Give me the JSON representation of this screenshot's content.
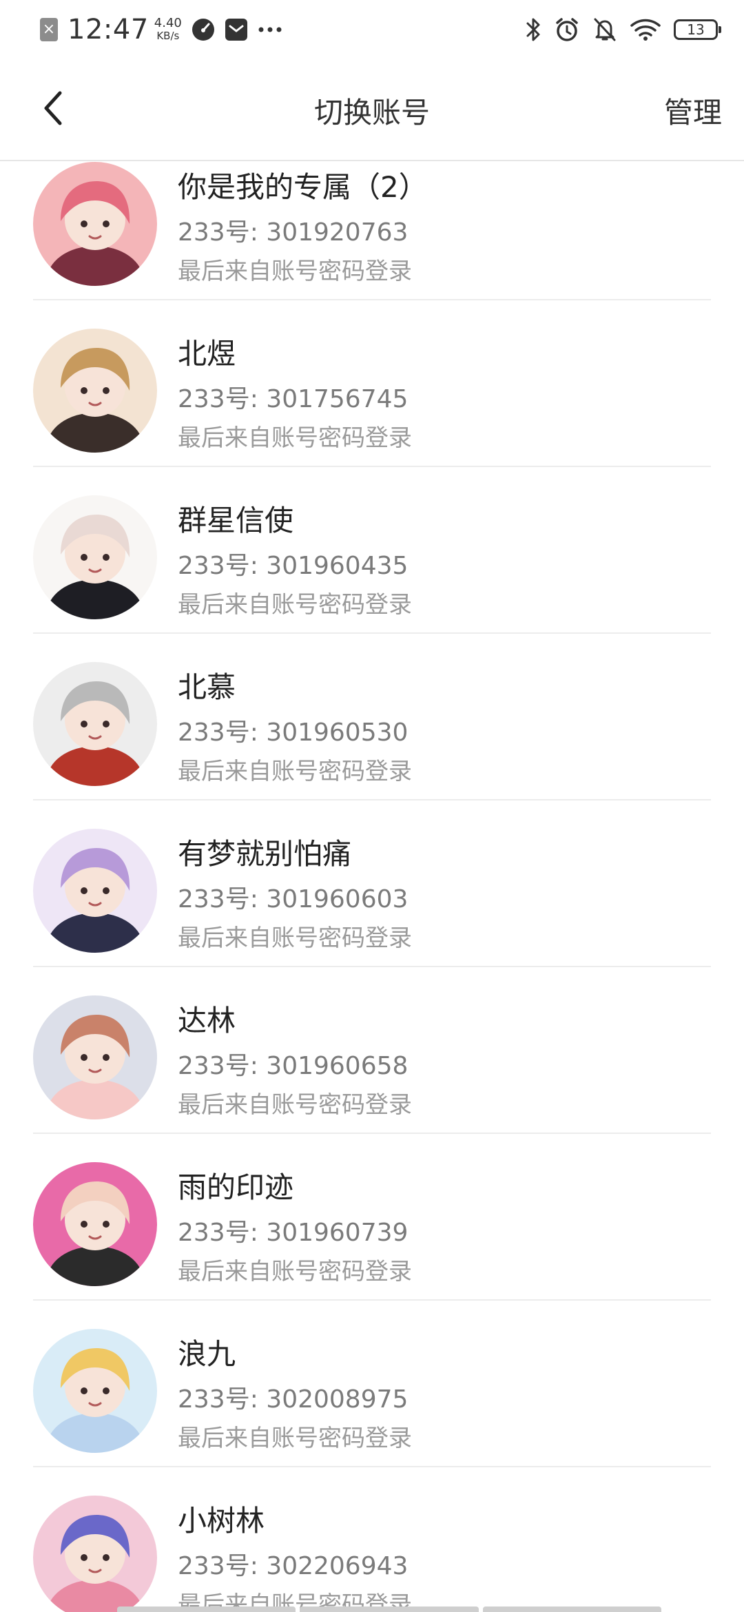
{
  "status_bar": {
    "time": "12:47",
    "speed_value": "4.40",
    "speed_unit": "KB/s",
    "battery": "13"
  },
  "header": {
    "title": "切换账号",
    "manage_label": "管理"
  },
  "accounts": [
    {
      "name": "你是我的专属（2）",
      "id": "233号: 301920763",
      "source": "最后来自账号密码登录",
      "avatar_colors": [
        "#f4b5b8",
        "#e46b7e",
        "#7a2f3f"
      ]
    },
    {
      "name": "北煜",
      "id": "233号: 301756745",
      "source": "最后来自账号密码登录",
      "avatar_colors": [
        "#f3e3d2",
        "#c79a5e",
        "#3a2e2a"
      ]
    },
    {
      "name": "群星信使",
      "id": "233号: 301960435",
      "source": "最后来自账号密码登录",
      "avatar_colors": [
        "#f8f6f4",
        "#e9d9d4",
        "#1e1e24"
      ]
    },
    {
      "name": "北慕",
      "id": "233号: 301960530",
      "source": "最后来自账号密码登录",
      "avatar_colors": [
        "#ededed",
        "#b9b9b9",
        "#b6362a"
      ]
    },
    {
      "name": "有梦就别怕痛",
      "id": "233号: 301960603",
      "source": "最后来自账号密码登录",
      "avatar_colors": [
        "#eee6f6",
        "#b79ad9",
        "#2d2f4a"
      ]
    },
    {
      "name": "达林",
      "id": "233号: 301960658",
      "source": "最后来自账号密码登录",
      "avatar_colors": [
        "#dcdfe9",
        "#c9826a",
        "#f6c8c6"
      ]
    },
    {
      "name": "雨的印迹",
      "id": "233号: 301960739",
      "source": "最后来自账号密码登录",
      "avatar_colors": [
        "#e86aa8",
        "#f3d0c0",
        "#2b2b2b"
      ]
    },
    {
      "name": "浪九",
      "id": "233号: 302008975",
      "source": "最后来自账号密码登录",
      "avatar_colors": [
        "#d9ecf7",
        "#f0c864",
        "#b9d3ee"
      ]
    },
    {
      "name": "小树林",
      "id": "233号: 302206943",
      "source": "最后来自账号密码登录",
      "avatar_colors": [
        "#f3c9d8",
        "#6a68c9",
        "#e98aa3"
      ]
    }
  ]
}
